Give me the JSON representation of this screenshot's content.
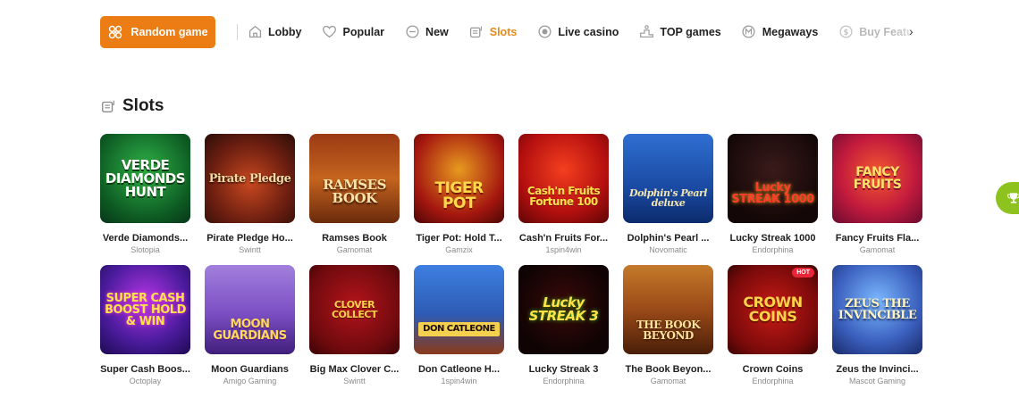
{
  "nav": {
    "random_label": "Random game",
    "items": [
      {
        "label": "Lobby",
        "icon": "home-icon",
        "state": "normal"
      },
      {
        "label": "Popular",
        "icon": "heart-icon",
        "state": "normal"
      },
      {
        "label": "New",
        "icon": "new-icon",
        "state": "normal"
      },
      {
        "label": "Slots",
        "icon": "slot-machine-icon",
        "state": "active"
      },
      {
        "label": "Live casino",
        "icon": "live-icon",
        "state": "normal"
      },
      {
        "label": "TOP games",
        "icon": "podium-icon",
        "state": "normal"
      },
      {
        "label": "Megaways",
        "icon": "megaways-icon",
        "state": "normal"
      },
      {
        "label": "Buy Feature",
        "icon": "dollar-icon",
        "state": "faded"
      }
    ],
    "next_icon": "chevron-right-icon"
  },
  "section": {
    "title": "Slots",
    "icon": "slot-machine-icon"
  },
  "colors": {
    "accent": "#ec7d14",
    "active": "#e58a1a",
    "widget": "#8ec21f",
    "hot": "#e8263a"
  },
  "games": [
    {
      "name": "Verde Diamonds...",
      "provider": "Slotopia",
      "art": "VERDE DIAMONDS HUNT"
    },
    {
      "name": "Pirate Pledge Ho...",
      "provider": "Swintt",
      "art": "Pirate Pledge"
    },
    {
      "name": "Ramses Book",
      "provider": "Gamomat",
      "art": "RAMSES BOOK"
    },
    {
      "name": "Tiger Pot: Hold T...",
      "provider": "Gamzix",
      "art": "TIGER POT"
    },
    {
      "name": "Cash'n Fruits For...",
      "provider": "1spin4win",
      "art": "Cash'n Fruits Fortune 100"
    },
    {
      "name": "Dolphin's Pearl ...",
      "provider": "Novomatic",
      "art": "Dolphin's Pearl deluxe"
    },
    {
      "name": "Lucky Streak 1000",
      "provider": "Endorphina",
      "art": "Lucky STREAK 1000"
    },
    {
      "name": "Fancy Fruits Fla...",
      "provider": "Gamomat",
      "art": "FANCY FRUITS"
    },
    {
      "name": "Super Cash Boos...",
      "provider": "Octoplay",
      "art": "SUPER CASH BOOST HOLD & WIN"
    },
    {
      "name": "Moon Guardians",
      "provider": "Amigo Gaming",
      "art": "MOON GUARDIANS"
    },
    {
      "name": "Big Max Clover C...",
      "provider": "Swintt",
      "art": "CLOVER COLLECT"
    },
    {
      "name": "Don Catleone H...",
      "provider": "1spin4win",
      "art": "DON CATLEONE"
    },
    {
      "name": "Lucky Streak 3",
      "provider": "Endorphina",
      "art": "Lucky STREAK 3"
    },
    {
      "name": "The Book Beyon...",
      "provider": "Gamomat",
      "art": "THE BOOK BEYOND"
    },
    {
      "name": "Crown Coins",
      "provider": "Endorphina",
      "art": "CROWN COINS",
      "badge": "HOT"
    },
    {
      "name": "Zeus the Invinci...",
      "provider": "Mascot Gaming",
      "art": "ZEUS THE INVINCIBLE"
    }
  ]
}
